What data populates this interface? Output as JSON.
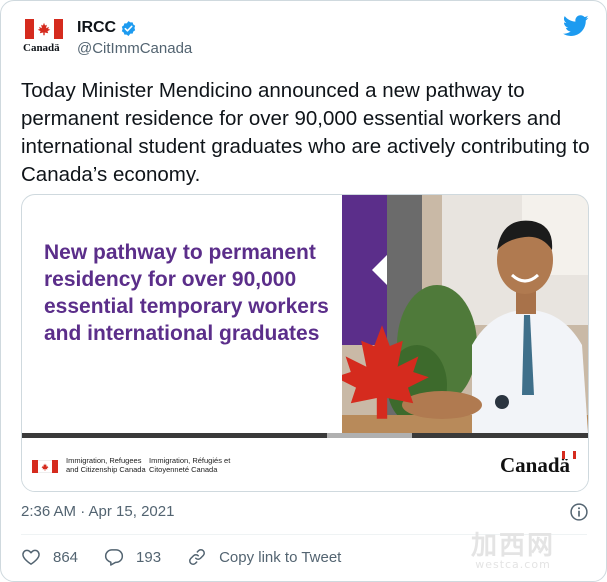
{
  "account": {
    "name": "IRCC",
    "handle": "@CitImmCanada",
    "avatar_wordmark": "Canadä"
  },
  "tweet": {
    "text": "Today Minister Mendicino announced a new pathway to permanent residence for over 90,000 essential workers and international student graduates who are actively contributing to Canada’s economy.",
    "timestamp": "2:36 AM · Apr 15, 2021"
  },
  "media": {
    "headline": "New pathway to permanent residency for over 90,000 essential temporary workers and international graduates",
    "dept_en": "Immigration, Refugees and Citizenship Canada",
    "dept_fr": "Immigration, Réfugiés et Citoyenneté Canada",
    "wordmark": "Canadä"
  },
  "actions": {
    "likes": "864",
    "replies": "193",
    "copy_link": "Copy link to Tweet"
  },
  "icons": [
    "verified-badge-icon",
    "twitter-bird-icon",
    "info-icon",
    "heart-icon",
    "reply-icon",
    "link-icon",
    "maple-leaf-icon"
  ],
  "colors": {
    "accent": "#1d9bf0",
    "headline_purple": "#5b2e8a",
    "canada_red": "#d52b1e",
    "muted_text": "#536471"
  },
  "watermark": {
    "main": "加西网",
    "sub": "westca.com"
  }
}
